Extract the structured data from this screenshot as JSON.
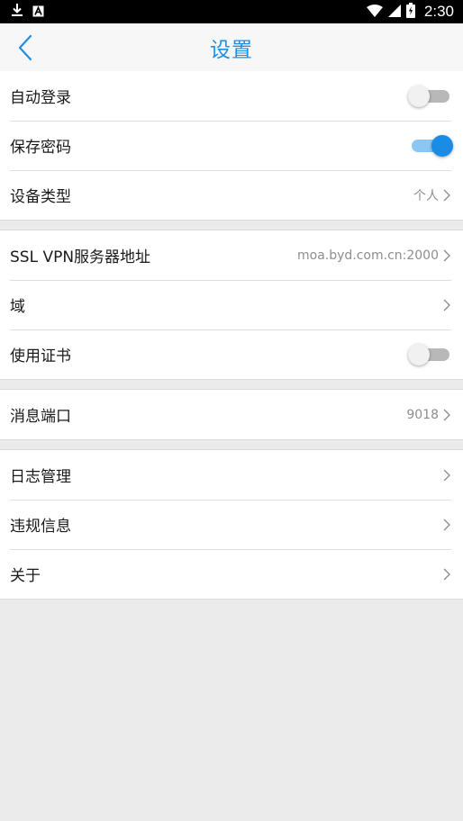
{
  "status_bar": {
    "time": "2:30",
    "left_icons": [
      "download-icon",
      "a-icon"
    ],
    "right_icons": [
      "wifi-icon",
      "signal-icon",
      "battery-icon"
    ]
  },
  "nav": {
    "title": "设置",
    "back_icon": "chevron-left-icon"
  },
  "groups": [
    {
      "items": [
        {
          "label": "自动登录",
          "type": "toggle",
          "on": false
        },
        {
          "label": "保存密码",
          "type": "toggle",
          "on": true
        },
        {
          "label": "设备类型",
          "type": "link",
          "value": "个人"
        }
      ]
    },
    {
      "items": [
        {
          "label": "SSL VPN服务器地址",
          "type": "link",
          "value": "moa.byd.com.cn:2000"
        },
        {
          "label": "域",
          "type": "link",
          "value": ""
        },
        {
          "label": "使用证书",
          "type": "toggle",
          "on": false
        }
      ]
    },
    {
      "items": [
        {
          "label": "消息端口",
          "type": "link",
          "value": "9018"
        }
      ]
    },
    {
      "items": [
        {
          "label": "日志管理",
          "type": "link",
          "value": ""
        },
        {
          "label": "违规信息",
          "type": "link",
          "value": ""
        },
        {
          "label": "关于",
          "type": "link",
          "value": ""
        }
      ]
    }
  ],
  "colors": {
    "accent": "#1e8fe3",
    "toggle_on_thumb": "#1b8ce6",
    "toggle_on_track": "#8cc6f2",
    "toggle_off_track": "#b8b8b8",
    "background": "#ebebeb"
  }
}
